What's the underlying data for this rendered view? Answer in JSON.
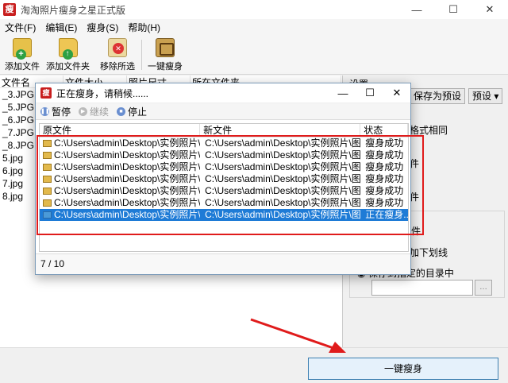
{
  "app": {
    "title": "淘淘照片瘦身之星正式版",
    "logo": "瘦"
  },
  "window_controls": [
    "—",
    "☐",
    "✕"
  ],
  "menu": [
    {
      "label": "文件(F)",
      "name": "menu-file"
    },
    {
      "label": "编辑(E)",
      "name": "menu-edit"
    },
    {
      "label": "瘦身(S)",
      "name": "menu-slim"
    },
    {
      "label": "帮助(H)",
      "name": "menu-help"
    }
  ],
  "toolbar": {
    "add_file": "添加文件",
    "add_folder": "添加文件夹",
    "remove_selected": "移除所选",
    "one_click_slim": "一键瘦身"
  },
  "file_list": {
    "columns": [
      "文件名",
      "文件大小",
      "照片尺寸",
      "所在文件夹"
    ],
    "rows": [
      "_3.JPG",
      "_5.JPG",
      "_6.JPG",
      "_7.JPG",
      "_8.JPG",
      "5.jpg",
      "6.jpg",
      "7.jpg",
      "8.jpg"
    ]
  },
  "settings": {
    "header": "设置",
    "save_preset": "保存为预设",
    "preset": "预设",
    "format_same": "格式相同",
    "opt1": "件",
    "opt2": "件",
    "group_label": "件",
    "underline": "加下划线",
    "save_dir": "保存到",
    "custom_dir": "指定的目录中"
  },
  "dialog": {
    "title": "正在瘦身，请稍候......",
    "logo": "瘦",
    "pause": "暂停",
    "continue": "继续",
    "stop": "停止",
    "columns": {
      "source": "原文件",
      "target": "新文件",
      "status": "状态"
    },
    "rows": [
      {
        "src": "C:\\Users\\admin\\Desktop\\实例照片\\图片...",
        "dst": "C:\\Users\\admin\\Desktop\\实例照片\\图片唯...",
        "status": "瘦身成功"
      },
      {
        "src": "C:\\Users\\admin\\Desktop\\实例照片\\图片...",
        "dst": "C:\\Users\\admin\\Desktop\\实例照片\\图片唯...",
        "status": "瘦身成功"
      },
      {
        "src": "C:\\Users\\admin\\Desktop\\实例照片\\图片...",
        "dst": "C:\\Users\\admin\\Desktop\\实例照片\\图片唯...",
        "status": "瘦身成功"
      },
      {
        "src": "C:\\Users\\admin\\Desktop\\实例照片\\图片...",
        "dst": "C:\\Users\\admin\\Desktop\\实例照片\\图片唯...",
        "status": "瘦身成功"
      },
      {
        "src": "C:\\Users\\admin\\Desktop\\实例照片\\图片...",
        "dst": "C:\\Users\\admin\\Desktop\\实例照片\\图片唯...",
        "status": "瘦身成功"
      },
      {
        "src": "C:\\Users\\admin\\Desktop\\实例照片\\图片...",
        "dst": "C:\\Users\\admin\\Desktop\\实例照片\\图片唯...",
        "status": "瘦身成功"
      },
      {
        "src": "C:\\Users\\admin\\Desktop\\实例照片\\图片...",
        "dst": "C:\\Users\\admin\\Desktop\\实例照片\\图片唯...",
        "status": "正在瘦身......"
      }
    ],
    "progress": "7 / 10"
  },
  "bottom": {
    "one_click_slim": "一键瘦身"
  },
  "colors": {
    "accent": "#1e7bd6",
    "highlight": "#e01b1b",
    "brand": "#c81e1e"
  }
}
